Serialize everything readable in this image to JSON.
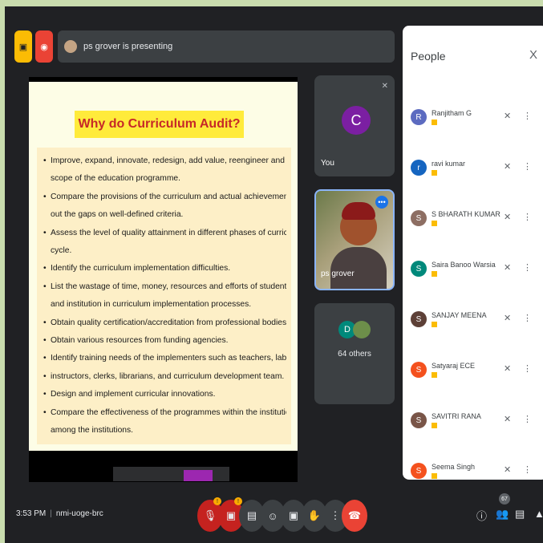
{
  "presenting": {
    "text": "ps grover is presenting",
    "avatar_icon": "user-photo"
  },
  "slide": {
    "title": "Why do Curriculum Audit?",
    "lines": [
      {
        "text": "Improve, expand, innovate, redesign, add value, reengineer and increase the",
        "bullet": true
      },
      {
        "text": "scope of the education programme.",
        "bullet": false
      },
      {
        "text": "Compare the provisions of the curriculum and actual achievements and find",
        "bullet": true
      },
      {
        "text": "out the gaps on well-defined criteria.",
        "bullet": false
      },
      {
        "text": "Assess the level of quality attainment in different phases of curriculum life",
        "bullet": true
      },
      {
        "text": "cycle.",
        "bullet": false
      },
      {
        "text": "Identify the curriculum implementation difficulties.",
        "bullet": true
      },
      {
        "text": "List the wastage of time, money, resources and efforts of students, teachers",
        "bullet": true
      },
      {
        "text": "and institution in curriculum implementation processes.",
        "bullet": false
      },
      {
        "text": "Obtain quality certification/accreditation from professional bodies.",
        "bullet": true
      },
      {
        "text": "Obtain various resources from funding agencies.",
        "bullet": true
      },
      {
        "text": "Identify training needs of the implementers such as teachers, laboratory",
        "bullet": true
      },
      {
        "text": "instructors, clerks, librarians, and curriculum development team.",
        "bullet": true
      },
      {
        "text": "Design and implement curricular innovations.",
        "bullet": true
      },
      {
        "text": "Compare the effectiveness of the programmes within the institution and",
        "bullet": true
      },
      {
        "text": "among the institutions.",
        "bullet": false
      }
    ]
  },
  "tiles": {
    "you": {
      "initial": "C",
      "label": "You"
    },
    "presenter": {
      "label": "ps grover",
      "more": "•••"
    },
    "others": {
      "initial": "D",
      "label": "64 others"
    }
  },
  "people": {
    "title": "People",
    "close": "X",
    "list": [
      {
        "name": "Ranjitham G",
        "initial": "R",
        "color": "#5c6bc0"
      },
      {
        "name": "ravi kumar",
        "initial": "r",
        "color": "#1565c0"
      },
      {
        "name": "S BHARATH KUMAR",
        "initial": "S",
        "color": "#8d6e63"
      },
      {
        "name": "Saira Banoo Warsia",
        "initial": "S",
        "color": "#00897b"
      },
      {
        "name": "SANJAY MEENA",
        "initial": "S",
        "color": "#5d4037"
      },
      {
        "name": "Satyaraj ECE",
        "initial": "S",
        "color": "#f4511e"
      },
      {
        "name": "SAVITRI RANA",
        "initial": "S",
        "color": "#795548"
      },
      {
        "name": "Seema Singh",
        "initial": "S",
        "color": "#f4511e"
      }
    ]
  },
  "meeting": {
    "time": "3:53 PM",
    "code": "nmi-uoge-brc",
    "participant_count": "67"
  },
  "colors": {
    "frame": "#c9dcae",
    "background": "#202124",
    "leave": "#ea4335",
    "accent": "#1a73e8"
  }
}
